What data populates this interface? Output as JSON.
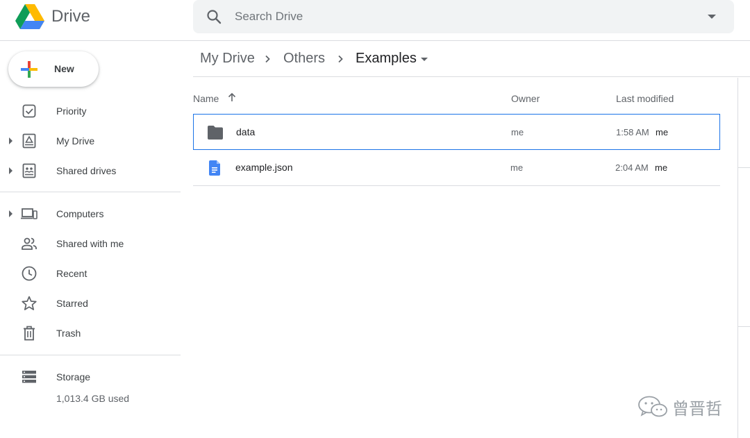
{
  "app": {
    "name": "Drive"
  },
  "search": {
    "placeholder": "Search Drive"
  },
  "sidebar": {
    "new_label": "New",
    "items": [
      {
        "label": "Priority",
        "icon": "priority-icon",
        "expandable": false
      },
      {
        "label": "My Drive",
        "icon": "my-drive-icon",
        "expandable": true
      },
      {
        "label": "Shared drives",
        "icon": "shared-drives-icon",
        "expandable": true
      },
      {
        "label": "Computers",
        "icon": "computers-icon",
        "expandable": true
      },
      {
        "label": "Shared with me",
        "icon": "shared-with-me-icon",
        "expandable": false
      },
      {
        "label": "Recent",
        "icon": "recent-icon",
        "expandable": false
      },
      {
        "label": "Starred",
        "icon": "star-icon",
        "expandable": false
      },
      {
        "label": "Trash",
        "icon": "trash-icon",
        "expandable": false
      }
    ],
    "storage": {
      "label": "Storage",
      "used": "1,013.4 GB used"
    }
  },
  "breadcrumb": [
    "My Drive",
    "Others",
    "Examples"
  ],
  "list": {
    "columns": {
      "name": "Name",
      "owner": "Owner",
      "modified": "Last modified"
    },
    "files": [
      {
        "name": "data",
        "type": "folder",
        "owner": "me",
        "modified_time": "1:58 AM",
        "modified_by": "me",
        "selected": true
      },
      {
        "name": "example.json",
        "type": "document",
        "owner": "me",
        "modified_time": "2:04 AM",
        "modified_by": "me",
        "selected": false
      }
    ]
  },
  "colors": {
    "accent": "#1a73e8",
    "text_primary": "#202124",
    "text_secondary": "#5f6368",
    "divider": "#dadce0"
  },
  "watermark": {
    "text": "曾晋哲",
    "icon": "wechat-icon"
  }
}
